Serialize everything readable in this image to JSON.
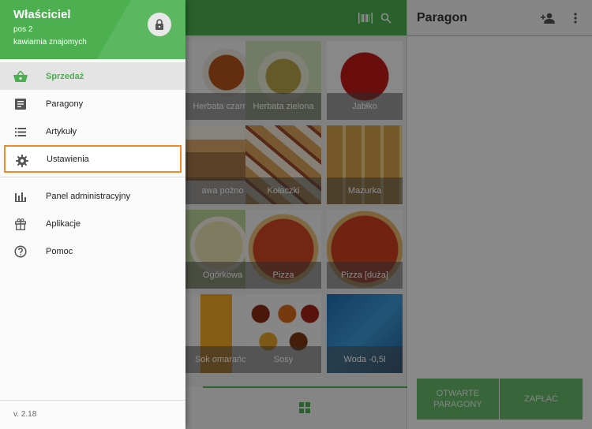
{
  "drawer": {
    "owner": "Właściciel",
    "pos": "pos 2",
    "venue": "kawiarnia znajomych",
    "version": "v. 2.18",
    "items": [
      {
        "label": "Sprzedaż",
        "icon": "basket-icon"
      },
      {
        "label": "Paragony",
        "icon": "receipts-icon"
      },
      {
        "label": "Artykuły",
        "icon": "list-icon"
      },
      {
        "label": "Ustawienia",
        "icon": "gear-icon"
      },
      {
        "label": "Panel administracyjny",
        "icon": "bar-chart-icon"
      },
      {
        "label": "Aplikacje",
        "icon": "gift-icon"
      },
      {
        "label": "Pomoc",
        "icon": "help-icon"
      }
    ]
  },
  "products": [
    {
      "name": "Herbata czarna"
    },
    {
      "name": "Herbata zielona"
    },
    {
      "name": "Jabłko"
    },
    {
      "name": "awa pożno"
    },
    {
      "name": "Kołaczki"
    },
    {
      "name": "Mazurka"
    },
    {
      "name": "Ogórkowa"
    },
    {
      "name": "Pizza"
    },
    {
      "name": "Pizza [duża]"
    },
    {
      "name": "Sok omarańcz"
    },
    {
      "name": "Sosy"
    },
    {
      "name": "Woda -0,5l"
    }
  ],
  "receipt": {
    "title": "Paragon",
    "open_receipts": "OTWARTE PARAGONY",
    "pay": "ZAPŁAĆ"
  },
  "colors": {
    "accent": "#4caf50",
    "highlight": "#f08a24"
  }
}
